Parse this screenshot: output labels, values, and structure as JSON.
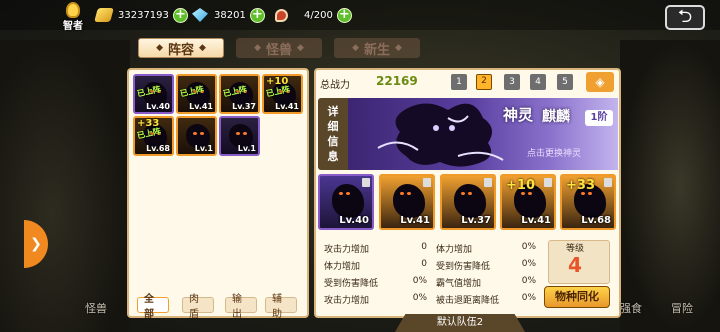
{
  "hud": {
    "sage_label": "智者",
    "gold": "33237193",
    "gems": "38201",
    "stamina": "4/200",
    "plus_symbol": "+"
  },
  "tabs": [
    {
      "label": "阵容",
      "active": true
    },
    {
      "label": "怪兽",
      "active": false
    },
    {
      "label": "新生",
      "active": false
    }
  ],
  "roster": {
    "slots": [
      {
        "tag": "已上阵",
        "level": "Lv.40",
        "plus": "",
        "frame": "purple"
      },
      {
        "tag": "已上阵",
        "level": "Lv.41",
        "plus": "",
        "frame": "orange"
      },
      {
        "tag": "已上阵",
        "level": "Lv.37",
        "plus": "",
        "frame": "orange"
      },
      {
        "tag": "已上阵",
        "level": "Lv.41",
        "plus": "+10",
        "frame": "orange"
      },
      {
        "tag": "已上阵",
        "level": "Lv.68",
        "plus": "+33",
        "frame": "orange"
      },
      {
        "tag": "",
        "level": "Lv.1",
        "plus": "",
        "frame": "orange"
      },
      {
        "tag": "",
        "level": "Lv.1",
        "plus": "",
        "frame": "purple"
      }
    ],
    "filters": [
      "全部",
      "肉盾",
      "输出",
      "辅助"
    ]
  },
  "lineup": {
    "power_label": "总战力",
    "power_value": "22169",
    "pages": [
      "1",
      "2",
      "3",
      "4",
      "5"
    ],
    "active_page": "2",
    "detail_tab": [
      "详",
      "细",
      "信",
      "息"
    ],
    "banner_title": "神灵",
    "banner_name": "麒麟",
    "banner_tier": "1阶",
    "banner_hint": "点击更换神灵",
    "team": [
      {
        "level": "Lv.40",
        "plus": "",
        "frame": "purple"
      },
      {
        "level": "Lv.41",
        "plus": "",
        "frame": "orange"
      },
      {
        "level": "Lv.37",
        "plus": "",
        "frame": "orange"
      },
      {
        "level": "Lv.41",
        "plus": "+10",
        "frame": "orange"
      },
      {
        "level": "Lv.68",
        "plus": "+33",
        "frame": "orange"
      }
    ],
    "stats_left": [
      {
        "label": "攻击力增加",
        "value": "0"
      },
      {
        "label": "体力增加",
        "value": "0"
      },
      {
        "label": "受到伤害降低",
        "value": "0%"
      },
      {
        "label": "攻击力增加",
        "value": "0%"
      }
    ],
    "stats_right": [
      {
        "label": "体力增加",
        "value": "0%"
      },
      {
        "label": "受到伤害降低",
        "value": "0%"
      },
      {
        "label": "霸气值增加",
        "value": "0%"
      },
      {
        "label": "被击退距离降低",
        "value": "0%"
      }
    ],
    "grade_label": "等级",
    "grade_value": "4",
    "sync_button": "物种同化",
    "team_name": "默认队伍2"
  },
  "bottom_nav": [
    "怪兽",
    "强食",
    "冒险"
  ],
  "colors": {
    "accent": "#f0a030",
    "power_green": "#6a8a10",
    "grade_red": "#e8552a",
    "banner_purple": "#5a3fa0"
  }
}
